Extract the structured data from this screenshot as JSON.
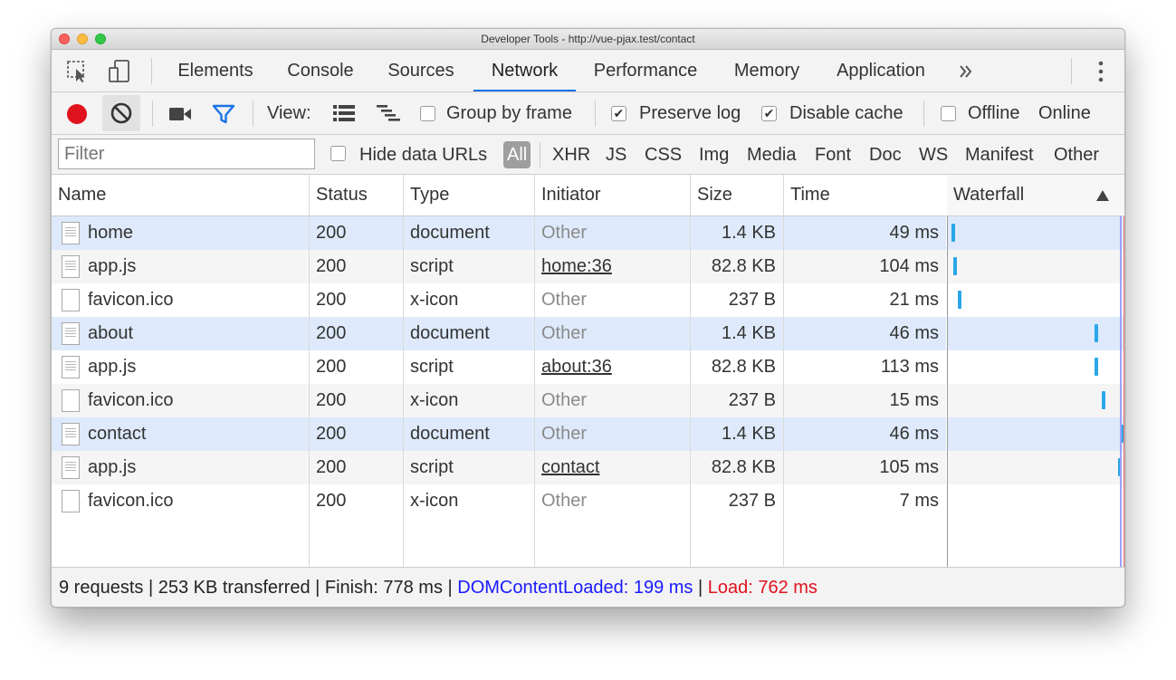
{
  "window": {
    "title": "Developer Tools - http://vue-pjax.test/contact"
  },
  "tabs": [
    {
      "label": "Elements"
    },
    {
      "label": "Console"
    },
    {
      "label": "Sources"
    },
    {
      "label": "Network"
    },
    {
      "label": "Performance"
    },
    {
      "label": "Memory"
    },
    {
      "label": "Application"
    }
  ],
  "toolbar": {
    "view_label": "View:",
    "group_by_frame": {
      "label": "Group by frame",
      "checked": false
    },
    "preserve_log": {
      "label": "Preserve log",
      "checked": true
    },
    "disable_cache": {
      "label": "Disable cache",
      "checked": true
    },
    "offline": {
      "label": "Offline",
      "checked": false
    },
    "throttle_value": "Online"
  },
  "filter": {
    "placeholder": "Filter",
    "hide_data_urls": {
      "label": "Hide data URLs",
      "checked": false
    },
    "types": [
      "All",
      "XHR",
      "JS",
      "CSS",
      "Img",
      "Media",
      "Font",
      "Doc",
      "WS",
      "Manifest",
      "Other"
    ]
  },
  "columns": {
    "name": "Name",
    "status": "Status",
    "type": "Type",
    "initiator": "Initiator",
    "size": "Size",
    "time": "Time",
    "waterfall": "Waterfall"
  },
  "rows": [
    {
      "name": "home",
      "status": "200",
      "type": "document",
      "initiator": "Other",
      "size": "1.4 KB",
      "time": "49 ms"
    },
    {
      "name": "app.js",
      "status": "200",
      "type": "script",
      "initiator": "home:36",
      "size": "82.8 KB",
      "time": "104 ms"
    },
    {
      "name": "favicon.ico",
      "status": "200",
      "type": "x-icon",
      "initiator": "Other",
      "size": "237 B",
      "time": "21 ms"
    },
    {
      "name": "about",
      "status": "200",
      "type": "document",
      "initiator": "Other",
      "size": "1.4 KB",
      "time": "46 ms"
    },
    {
      "name": "app.js",
      "status": "200",
      "type": "script",
      "initiator": "about:36",
      "size": "82.8 KB",
      "time": "113 ms"
    },
    {
      "name": "favicon.ico",
      "status": "200",
      "type": "x-icon",
      "initiator": "Other",
      "size": "237 B",
      "time": "15 ms"
    },
    {
      "name": "contact",
      "status": "200",
      "type": "document",
      "initiator": "Other",
      "size": "1.4 KB",
      "time": "46 ms"
    },
    {
      "name": "app.js",
      "status": "200",
      "type": "script",
      "initiator": "contact",
      "size": "82.8 KB",
      "time": "105 ms"
    },
    {
      "name": "favicon.ico",
      "status": "200",
      "type": "x-icon",
      "initiator": "Other",
      "size": "237 B",
      "time": "7 ms"
    }
  ],
  "status": {
    "requests": "9 requests",
    "transferred": "253 KB transferred",
    "finish": "Finish: 778 ms",
    "dom_content_loaded": "DOMContentLoaded: 199 ms",
    "load": "Load: 762 ms",
    "separator": " | "
  },
  "colors": {
    "accent": "#1a73e8",
    "record": "#e0121e",
    "filter_icon": "#1a73e8",
    "dcl": "#1a1aff",
    "load": "#e0121e",
    "row_highlight": "#deeafb",
    "row_alt": "#f5f5f5",
    "waterfall_bar": "#2aa7e8"
  },
  "icons": {
    "inspect": "inspect-element-icon",
    "device": "device-toolbar-icon",
    "more_tabs": "chevron-double-right-icon",
    "menu": "kebab-menu-icon",
    "record": "record-icon",
    "clear": "clear-icon",
    "capture": "video-camera-icon",
    "filter": "filter-icon",
    "list_view": "list-view-icon",
    "overview": "waterfall-overview-icon",
    "sort": "sort-ascending-icon"
  }
}
